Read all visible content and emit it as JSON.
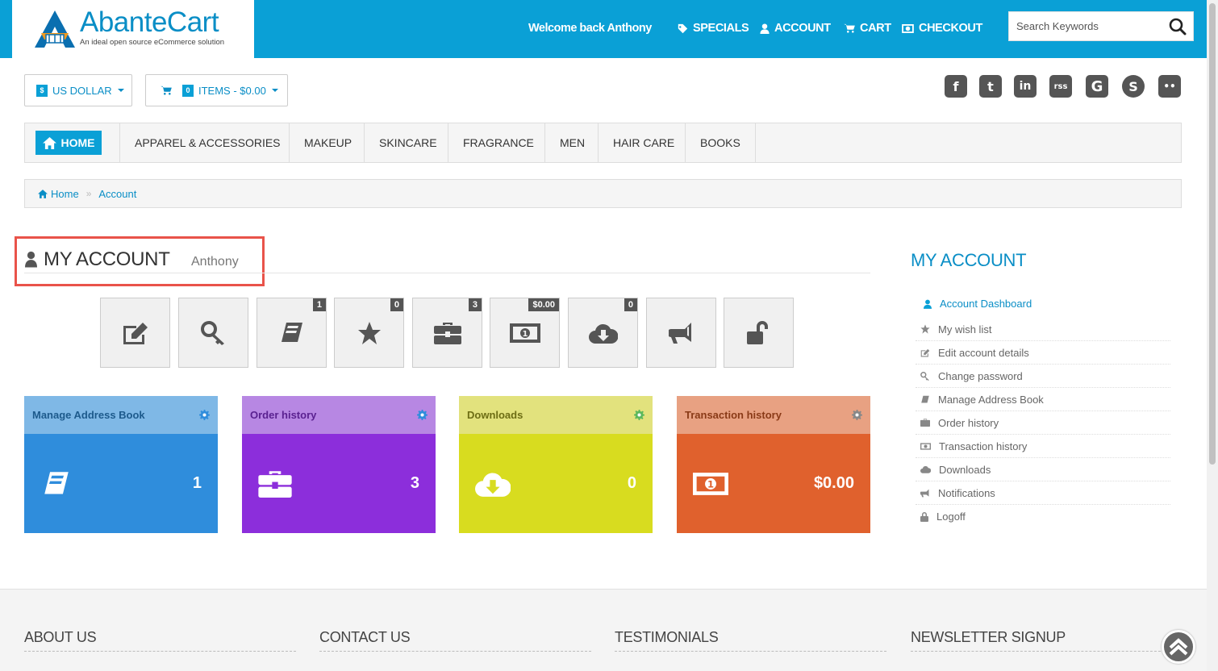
{
  "header": {
    "logo_name": "AbanteCart",
    "logo_tagline": "An ideal open source eCommerce solution",
    "welcome": "Welcome back Anthony",
    "nav": {
      "specials": "SPECIALS",
      "account": "ACCOUNT",
      "cart": "CART",
      "checkout": "CHECKOUT"
    },
    "search_placeholder": "Search Keywords",
    "accent_color": "#0aa0d6"
  },
  "toolbar": {
    "currency_symbol": "$",
    "currency": "US DOLLAR",
    "cart_count": "0",
    "cart_summary": "ITEMS - $0.00"
  },
  "social": [
    "f",
    "t",
    "in",
    "rss",
    "G",
    "S",
    "••"
  ],
  "categories": {
    "home": "HOME",
    "items": [
      "APPAREL & ACCESSORIES",
      "MAKEUP",
      "SKINCARE",
      "FRAGRANCE",
      "MEN",
      "HAIR CARE",
      "BOOKS"
    ]
  },
  "breadcrumb": {
    "home": "Home",
    "current": "Account"
  },
  "page": {
    "title": "MY ACCOUNT",
    "subtitle": "Anthony"
  },
  "tiles": [
    {
      "icon": "edit-icon",
      "badge": ""
    },
    {
      "icon": "key-icon",
      "badge": ""
    },
    {
      "icon": "book-icon",
      "badge": "1"
    },
    {
      "icon": "star-icon",
      "badge": "0"
    },
    {
      "icon": "briefcase-icon",
      "badge": "3"
    },
    {
      "icon": "money-icon",
      "badge": "$0.00"
    },
    {
      "icon": "cloud-download-icon",
      "badge": "0"
    },
    {
      "icon": "bullhorn-icon",
      "badge": ""
    },
    {
      "icon": "unlock-icon",
      "badge": ""
    }
  ],
  "cards": [
    {
      "title": "Manage Address Book",
      "value": "1",
      "head_color": "#7fb8e6",
      "body_color": "#2f8ddc",
      "title_color": "#1d5a8c"
    },
    {
      "title": "Order history",
      "value": "3",
      "head_color": "#b787e3",
      "body_color": "#8c2edb",
      "title_color": "#5a2190"
    },
    {
      "title": "Downloads",
      "value": "0",
      "head_color": "#e2e27d",
      "body_color": "#d8dc1f",
      "title_color": "#6d6d14"
    },
    {
      "title": "Transaction history",
      "value": "$0.00",
      "head_color": "#e8a182",
      "body_color": "#e0612d",
      "title_color": "#8a3a17"
    }
  ],
  "sidebar": {
    "title": "MY ACCOUNT",
    "items": [
      {
        "label": "Account Dashboard",
        "icon": "user-icon"
      },
      {
        "label": "My wish list",
        "icon": "star-icon"
      },
      {
        "label": "Edit account details",
        "icon": "edit-icon"
      },
      {
        "label": "Change password",
        "icon": "key-icon"
      },
      {
        "label": "Manage Address Book",
        "icon": "book-icon"
      },
      {
        "label": "Order history",
        "icon": "briefcase-icon"
      },
      {
        "label": "Transaction history",
        "icon": "money-icon"
      },
      {
        "label": "Downloads",
        "icon": "cloud-download-icon"
      },
      {
        "label": "Notifications",
        "icon": "bullhorn-icon"
      },
      {
        "label": "Logoff",
        "icon": "lock-icon"
      }
    ]
  },
  "footer": {
    "about": "ABOUT US",
    "contact": "CONTACT US",
    "testimonials": "TESTIMONIALS",
    "newsletter": "NEWSLETTER SIGNUP"
  }
}
